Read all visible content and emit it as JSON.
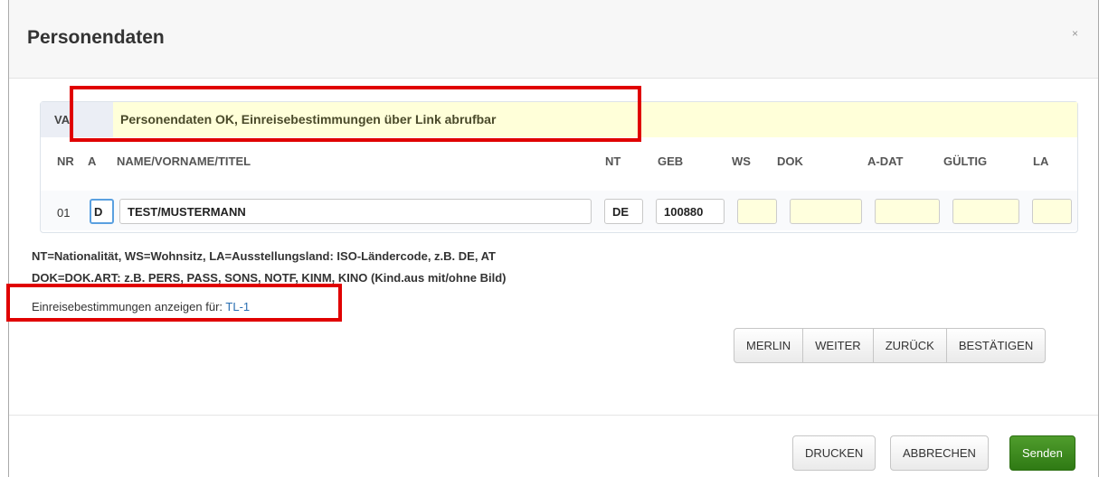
{
  "dialog": {
    "title": "Personendaten",
    "close": "×"
  },
  "va": {
    "label": "VA",
    "message": "Personendaten OK, Einreisebestimmungen über Link abrufbar"
  },
  "table": {
    "headers": [
      "NR",
      "A",
      "NAME/VORNAME/TITEL",
      "NT",
      "GEB",
      "WS",
      "DOK",
      "A-DAT",
      "GÜLTIG",
      "LA"
    ],
    "rows": [
      {
        "nr": "01",
        "a": "D",
        "name": "TEST/MUSTERMANN",
        "nt": "DE",
        "geb": "100880",
        "ws": "",
        "dok": "",
        "a_dat": "",
        "gueltig": "",
        "la": ""
      }
    ]
  },
  "help": {
    "line1": "NT=Nationalität, WS=Wohnsitz, LA=Ausstellungsland: ISO-Ländercode, z.B. DE, AT",
    "line2": "DOK=DOK.ART: z.B. PERS, PASS, SONS, NOTF, KINM, KINO (Kind.aus mit/ohne Bild)"
  },
  "einreise": {
    "label": "Einreisebestimmungen anzeigen für:",
    "link": "TL-1"
  },
  "actions": [
    "MERLIN",
    "WEITER",
    "ZURÜCK",
    "BESTÄTIGEN"
  ],
  "footer": {
    "print": "DRUCKEN",
    "cancel": "ABBRECHEN",
    "send": "Senden"
  },
  "colors": {
    "highlight_box": "#e00000",
    "send_button": "#3b8a1f",
    "link": "#2a6fb3",
    "message_bg": "#ffffd9"
  }
}
